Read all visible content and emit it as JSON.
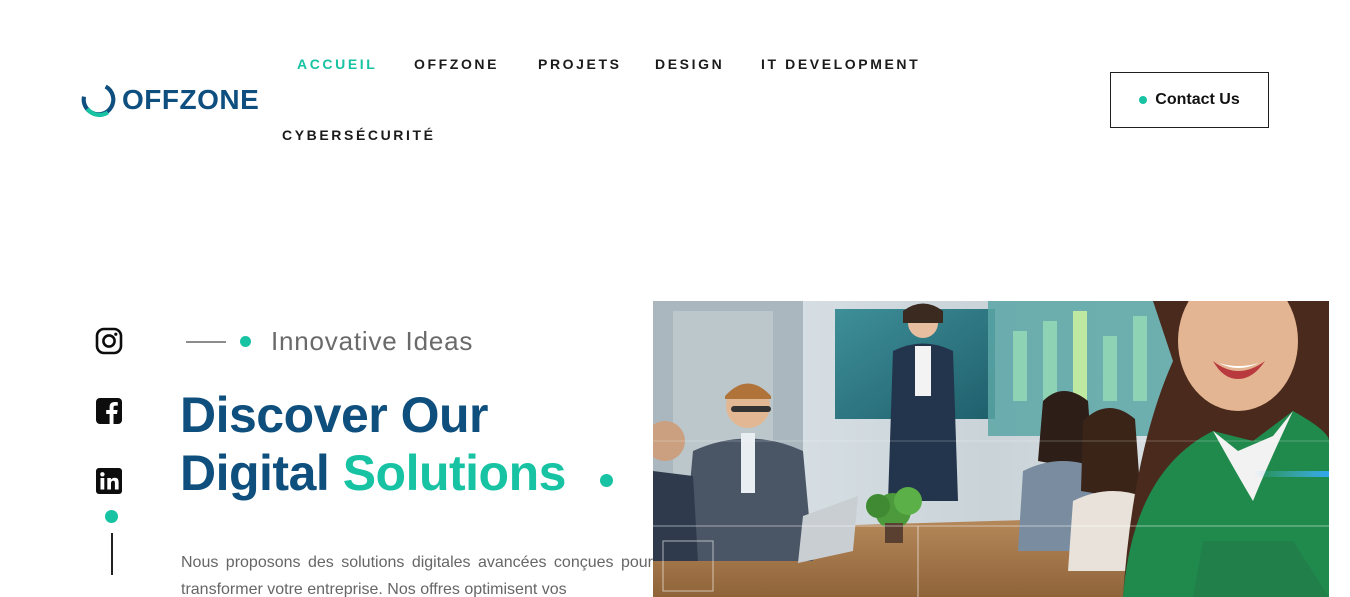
{
  "header": {
    "logo_text": "OFFZONE",
    "nav": [
      {
        "label": "ACCUEIL",
        "active": true
      },
      {
        "label": "OFFZONE",
        "active": false
      },
      {
        "label": "PROJETS",
        "active": false
      },
      {
        "label": "DESIGN",
        "active": false
      },
      {
        "label": "IT DEVELOPMENT",
        "active": false
      },
      {
        "label": "CYBERSÉCURITÉ",
        "active": false
      }
    ],
    "contact_label": "Contact Us"
  },
  "social": {
    "icons": [
      "instagram-icon",
      "facebook-icon",
      "linkedin-icon"
    ]
  },
  "hero": {
    "eyebrow": "Innovative Ideas",
    "headline_line1": "Discover Our",
    "headline_line2_plain": "Digital ",
    "headline_line2_accent": "Solutions",
    "paragraph": "Nous proposons des solutions digitales avancées conçues pour transformer votre entreprise. Nos offres optimisent vos"
  },
  "colors": {
    "accent": "#17c3a3",
    "brand": "#0e4f7d",
    "text": "#1b1b1b",
    "muted": "#666666"
  }
}
